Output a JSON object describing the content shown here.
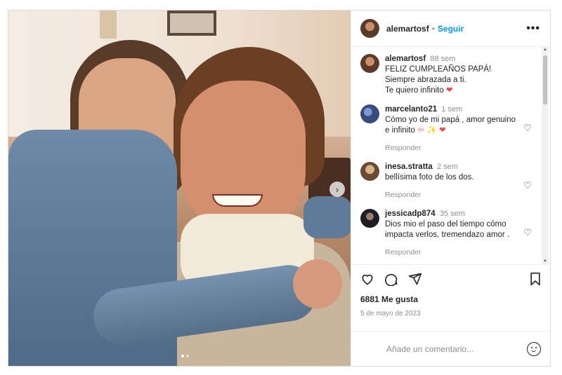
{
  "post": {
    "username": "alemartosf",
    "separator": "•",
    "follow_label": "Seguir",
    "more_label": "•••",
    "carousel": {
      "next_label": "›",
      "dot_count": 2,
      "active_index": 0
    }
  },
  "caption": {
    "username": "alemartosf",
    "time": "88 sem",
    "lines": [
      "FELIZ CUMPLEAÑOS PAPÁ!",
      "Siempre abrazada a ti.",
      "Te quiero infinito"
    ],
    "emoji": "❤"
  },
  "comments": [
    {
      "username": "marcelanto21",
      "time": "1 sem",
      "text": "Cómo yo de mi papá , amor genuino e infinito",
      "emoji": "♾ ✨ ❤",
      "reply_label": "Responder",
      "avatar_color": "#3a4a7a"
    },
    {
      "username": "inesa.stratta",
      "time": "2 sem",
      "text": "bellísima foto de los dos.",
      "reply_label": "Responder",
      "avatar_color": "#8a6a4a"
    },
    {
      "username": "jessicadp874",
      "time": "35 sem",
      "text": "Dios mio el paso del tiempo cómo impacta verlos, tremendazo amor .",
      "reply_label": "Responder",
      "avatar_color": "#2a2a30"
    }
  ],
  "actions": {
    "likes": "6881 Me gusta",
    "date": "5 de mayo de 2023"
  },
  "add_comment": {
    "placeholder": "Añade un comentario..."
  },
  "colors": {
    "accent": "#0095f6",
    "secondary_text": "#8e8e8e",
    "like_red": "#ed4956"
  }
}
